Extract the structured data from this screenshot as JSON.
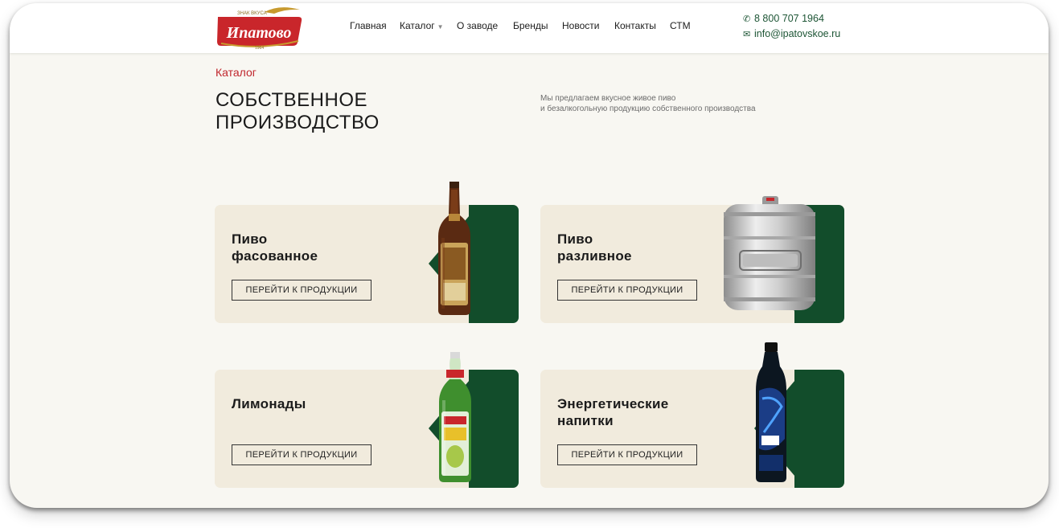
{
  "header": {
    "logo": {
      "top": "ЗНАК ВКУСА",
      "name": "Ипатово",
      "year": "1964"
    },
    "nav": [
      {
        "label": "Главная"
      },
      {
        "label": "Каталог"
      },
      {
        "label": "О заводе"
      },
      {
        "label": "Бренды"
      },
      {
        "label": "Новости"
      },
      {
        "label": "Контакты"
      },
      {
        "label": "СТМ"
      }
    ],
    "phone": "8 800 707 1964",
    "email": "info@ipatovskoe.ru"
  },
  "page": {
    "breadcrumb": "Каталог",
    "title_line1": "СОБСТВЕННОЕ",
    "title_line2": "ПРОИЗВОДСТВО",
    "description_line1": "Мы предлагаем вкусное живое пиво",
    "description_line2": "и безалкогольную продукцию собственного производства"
  },
  "cards": [
    {
      "title_line1": "Пиво",
      "title_line2": "фасованное",
      "button": "ПЕРЕЙТИ К ПРОДУКЦИИ"
    },
    {
      "title_line1": "Пиво",
      "title_line2": "разливное",
      "button": "ПЕРЕЙТИ К ПРОДУКЦИИ"
    },
    {
      "title_line1": "Лимонады",
      "title_line2": "",
      "button": "ПЕРЕЙТИ К ПРОДУКЦИИ"
    },
    {
      "title_line1": "Энергетические",
      "title_line2": "напитки",
      "button": "ПЕРЕЙТИ К ПРОДУКЦИИ"
    }
  ],
  "colors": {
    "brand_red": "#c0262d",
    "brand_green": "#124d2b",
    "card_bg": "#f1ebdd",
    "page_bg": "#f8f7f2"
  },
  "icons": [
    "phone-icon",
    "mail-icon",
    "chevron-down-icon"
  ]
}
